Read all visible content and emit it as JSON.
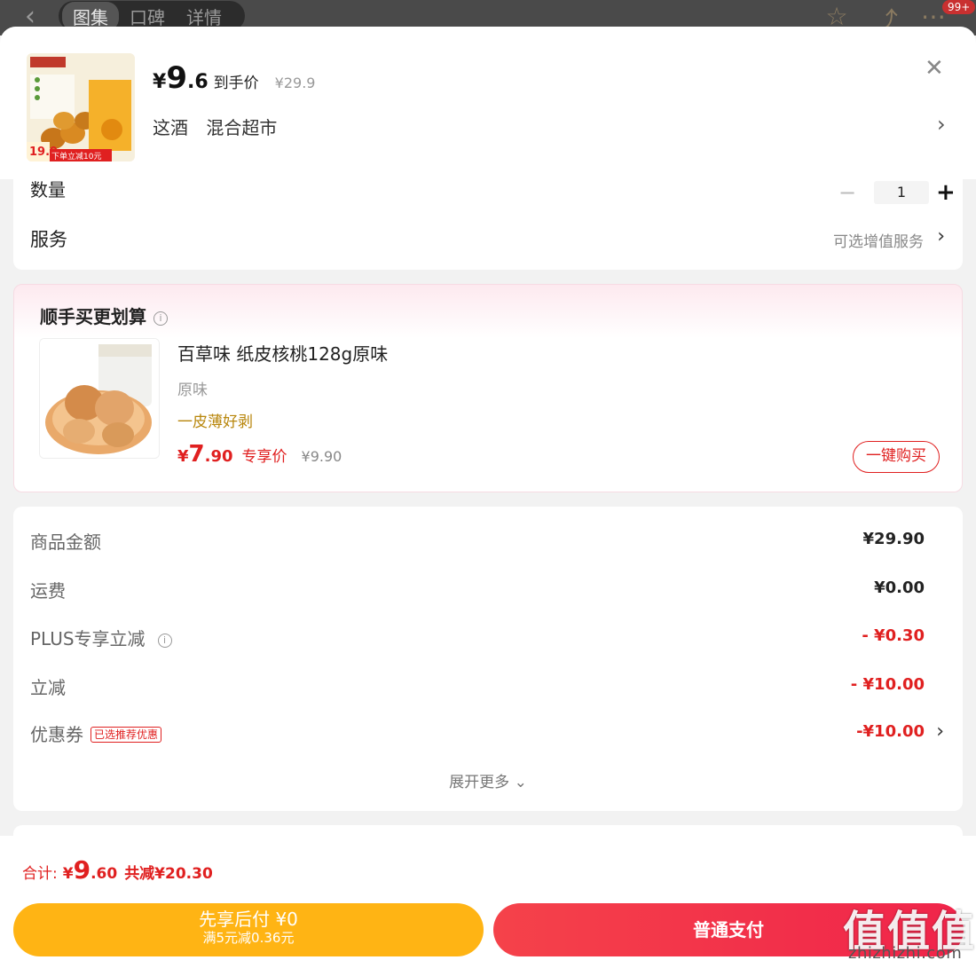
{
  "nav": {
    "tabs": [
      "图集",
      "口碑",
      "详情"
    ],
    "badge": "99+"
  },
  "product": {
    "price_symbol": "¥",
    "price_integer": "9",
    "price_decimal": ".6",
    "price_label": "到手价",
    "original_price": "¥29.9",
    "specs": [
      "这酒",
      "混合超市"
    ],
    "image_badge_price": "19.9",
    "image_badge_text": "下单立减10元"
  },
  "quantity": {
    "label": "数量",
    "value": "1"
  },
  "service": {
    "label": "服务",
    "value": "可选增值服务"
  },
  "bundle": {
    "title": "顺手买更划算",
    "name": "百草味 纸皮核桃128g原味",
    "flavor": "原味",
    "slogan": "一皮薄好剥",
    "price_symbol": "¥",
    "price_integer": "7",
    "price_decimal": ".90",
    "price_label": "专享价",
    "original_price": "¥9.90",
    "buy_label": "一键购买"
  },
  "summary": {
    "rows": [
      {
        "label": "商品金额",
        "value": "¥29.90"
      },
      {
        "label": "运费",
        "value": "¥0.00"
      },
      {
        "label": "PLUS专享立减",
        "value": "- ¥0.30"
      },
      {
        "label": "立减",
        "value": "- ¥10.00"
      },
      {
        "label": "优惠券",
        "tag": "已选推荐优惠",
        "value": "-¥10.00"
      }
    ],
    "expand_label": "展开更多"
  },
  "footer": {
    "total_label": "合计:",
    "total_symbol": "¥",
    "total_integer": "9",
    "total_decimal": ".60",
    "total_saving": "共减¥20.30",
    "later_pay_title": "先享后付 ¥0",
    "later_pay_sub": "满5元减0.36元",
    "pay_label": "普通支付"
  },
  "watermark": {
    "text": "值值值",
    "domain": "zhizhizhi.com"
  },
  "colors": {
    "accent_red": "#e02020",
    "later_pay_yellow": "#ffb414",
    "pay_red": "#f0244a",
    "slogan_gold": "#b8860b"
  }
}
